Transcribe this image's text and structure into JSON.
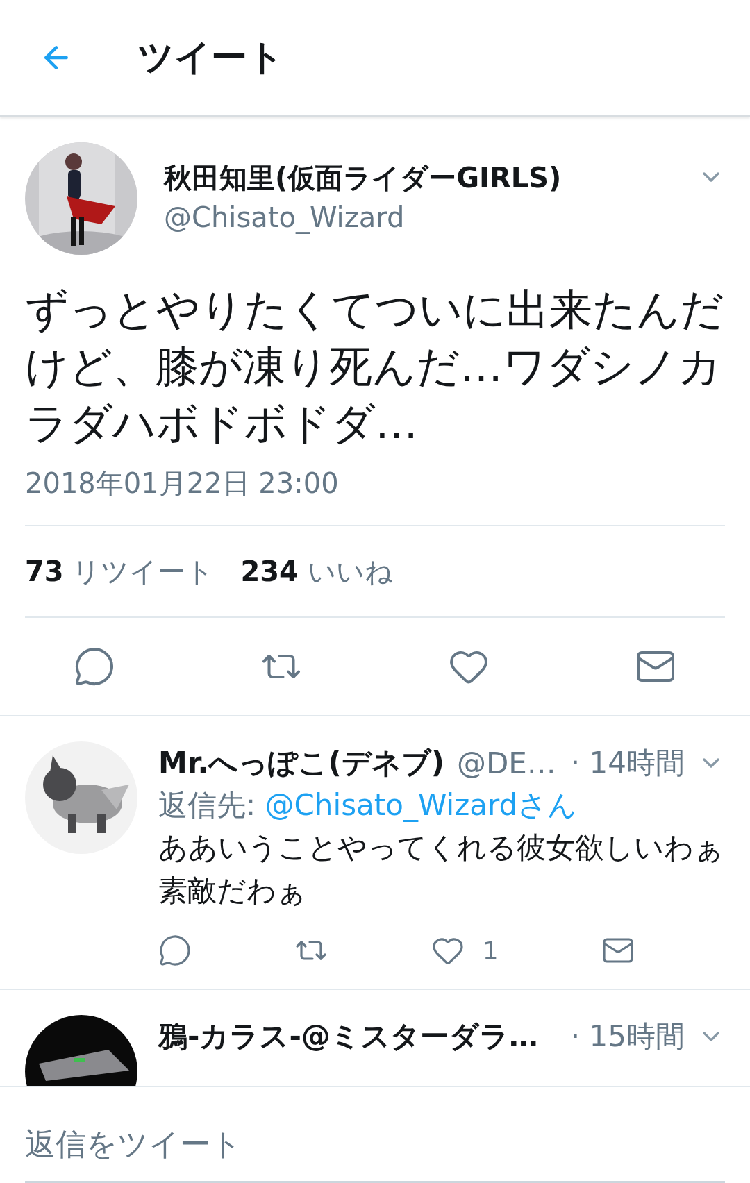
{
  "header": {
    "title": "ツイート"
  },
  "tweet": {
    "name": "秋田知里(仮面ライダーGIRLS)",
    "handle": "@Chisato_Wizard",
    "text": "ずっとやりたくてついに出来たんだけど、膝が凍り死んだ…ワダシノカラダハボドボドダ…",
    "timestamp": "2018年01月22日 23:00",
    "stats": [
      {
        "count": "73",
        "label": "リツイート"
      },
      {
        "count": "234",
        "label": "いいね"
      }
    ],
    "actions": [
      {
        "kind": "reply"
      },
      {
        "kind": "retweet"
      },
      {
        "kind": "like"
      },
      {
        "kind": "message"
      }
    ]
  },
  "replies": [
    {
      "name": "Mr.へっぽこ(デネブ)",
      "handle": "@DE…",
      "time": "· 14時間",
      "reply_to_label": "返信先:",
      "reply_to": "@Chisato_Wizardさん",
      "text": "ああいうことやってくれる彼女欲しいわぁ素敵だわぁ",
      "actions": [
        {
          "kind": "reply"
        },
        {
          "kind": "retweet"
        },
        {
          "kind": "like",
          "count": "1"
        },
        {
          "kind": "message"
        }
      ]
    },
    {
      "name": "鴉-カラス-@ミスターダラ…",
      "time": "· 15時間"
    }
  ],
  "compose": {
    "placeholder": "返信をツイート"
  }
}
